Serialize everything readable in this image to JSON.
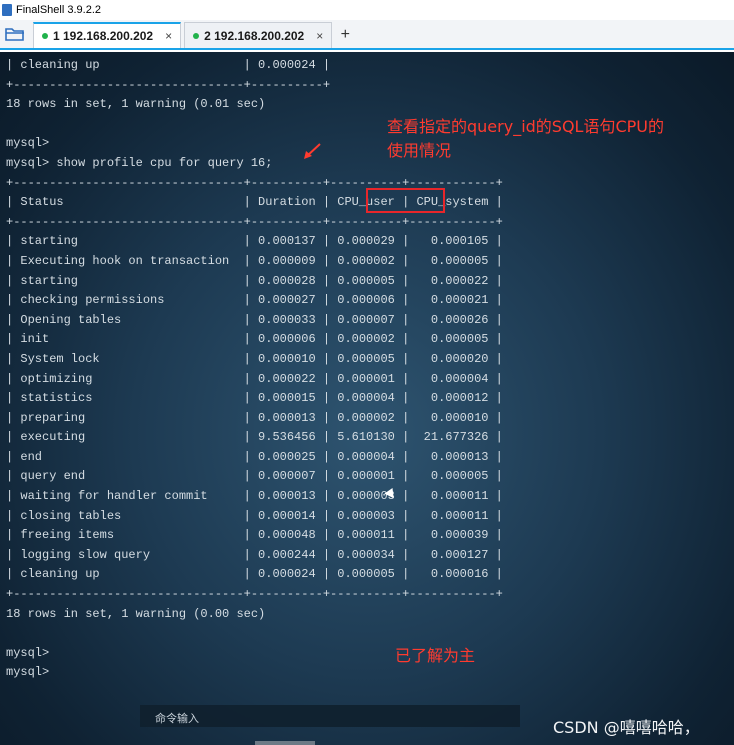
{
  "window": {
    "title": "FinalShell 3.9.2.2"
  },
  "tabs": [
    {
      "label": "1 192.168.200.202",
      "close": "×",
      "status_color": "#21b24b",
      "active": true
    },
    {
      "label": "2 192.168.200.202",
      "close": "×",
      "status_color": "#21b24b",
      "active": false
    }
  ],
  "tabbar": {
    "add_label": "+",
    "folder_icon": "folder-icon"
  },
  "terminal": {
    "text": "| cleaning up                    | 0.000024 |\n+--------------------------------+----------+\n18 rows in set, 1 warning (0.01 sec)\n\nmysql>\nmysql> show profile cpu for query 16;\n+--------------------------------+----------+----------+------------+\n| Status                         | Duration | CPU_user | CPU_system |\n+--------------------------------+----------+----------+------------+\n| starting                       | 0.000137 | 0.000029 |   0.000105 |\n| Executing hook on transaction  | 0.000009 | 0.000002 |   0.000005 |\n| starting                       | 0.000028 | 0.000005 |   0.000022 |\n| checking permissions           | 0.000027 | 0.000006 |   0.000021 |\n| Opening tables                 | 0.000033 | 0.000007 |   0.000026 |\n| init                           | 0.000006 | 0.000002 |   0.000005 |\n| System lock                    | 0.000010 | 0.000005 |   0.000020 |\n| optimizing                     | 0.000022 | 0.000001 |   0.000004 |\n| statistics                     | 0.000015 | 0.000004 |   0.000012 |\n| preparing                      | 0.000013 | 0.000002 |   0.000010 |\n| executing                      | 9.536456 | 5.610130 |  21.677326 |\n| end                            | 0.000025 | 0.000004 |   0.000013 |\n| query end                      | 0.000007 | 0.000001 |   0.000005 |\n| waiting for handler commit     | 0.000013 | 0.000003 |   0.000011 |\n| closing tables                 | 0.000014 | 0.000003 |   0.000011 |\n| freeing items                  | 0.000048 | 0.000011 |   0.000039 |\n| logging slow query             | 0.000244 | 0.000034 |   0.000127 |\n| cleaning up                    | 0.000024 | 0.000005 |   0.000016 |\n+--------------------------------+----------+----------+------------+\n18 rows in set, 1 warning (0.00 sec)\n\nmysql>\nmysql>"
  },
  "annotations": {
    "top": "查看指定的query_id的SQL语句CPU的\n使用情况",
    "bottom": "已了解为主",
    "color": "#ff3b2f"
  },
  "command_input": {
    "label": "命令输入"
  },
  "watermark": "CSDN @嘻嘻哈哈，"
}
